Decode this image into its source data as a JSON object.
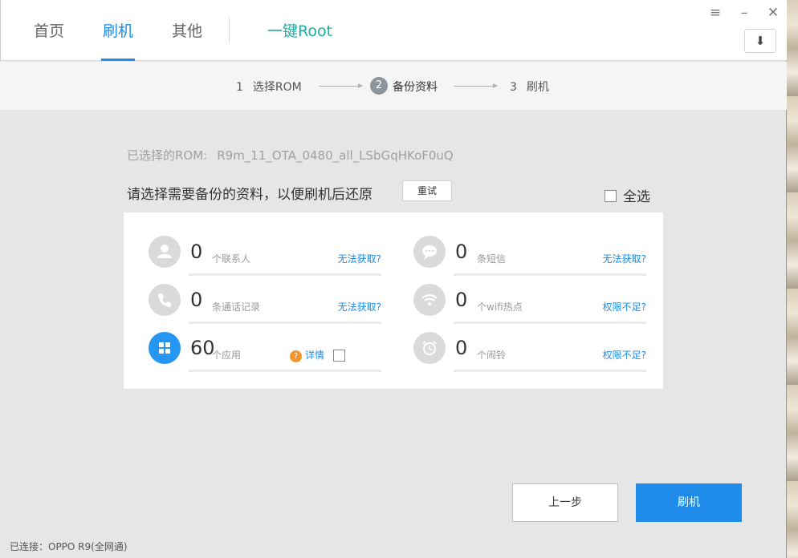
{
  "nav": {
    "home": "首页",
    "flash": "刷机",
    "other": "其他",
    "root": "一键Root"
  },
  "window": {
    "menu_icon": "menu-icon",
    "minimize_icon": "minimize-icon",
    "close_icon": "close-icon",
    "download_icon": "download-icon"
  },
  "steps": [
    {
      "num": "1",
      "label": "选择ROM"
    },
    {
      "num": "2",
      "label": "备份资料"
    },
    {
      "num": "3",
      "label": "刷机"
    }
  ],
  "rom": {
    "prefix": "已选择的ROM:",
    "name": "R9m_11_OTA_0480_all_LSbGqHKoF0uQ"
  },
  "prompt": "请选择需要备份的资料，以便刷机后还原",
  "retry_label": "重试",
  "select_all_label": "全选",
  "items": [
    {
      "icon": "contact-icon",
      "count": "0",
      "label": "个联系人",
      "link": "无法获取?"
    },
    {
      "icon": "sms-icon",
      "count": "0",
      "label": "条短信",
      "link": "无法获取?"
    },
    {
      "icon": "phone-icon",
      "count": "0",
      "label": "条通话记录",
      "link": "无法获取?"
    },
    {
      "icon": "wifi-icon",
      "count": "0",
      "label": "个wifi热点",
      "link": "权限不足?"
    },
    {
      "icon": "apps-icon",
      "count": "60",
      "label": "个应用",
      "help": "详情"
    },
    {
      "icon": "alarm-icon",
      "count": "0",
      "label": "个闹铃",
      "link": "权限不足?"
    }
  ],
  "buttons": {
    "prev": "上一步",
    "flash": "刷机"
  },
  "status": "已连接：OPPO R9(全网通)",
  "colors": {
    "accent": "#1e8ce8",
    "root": "#17b0a7",
    "warning": "#f0962d"
  }
}
